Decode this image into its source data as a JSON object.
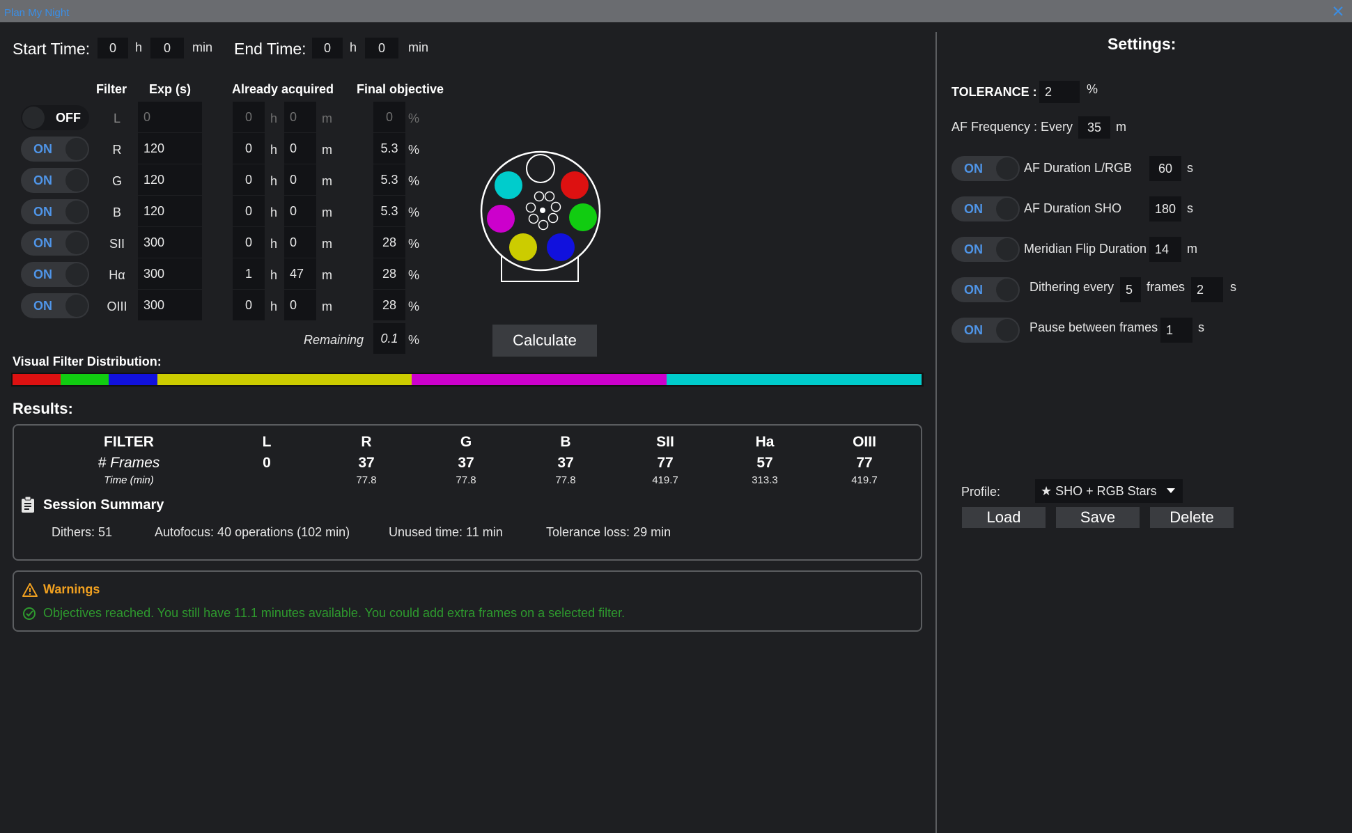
{
  "window": {
    "title": "Plan My Night"
  },
  "time": {
    "start_label": "Start Time:",
    "start_h": "0",
    "start_m": "0",
    "end_label": "End Time:",
    "end_h": "0",
    "end_m": "0",
    "h_unit": "h",
    "min_unit": "min"
  },
  "filters": {
    "headers": {
      "filter": "Filter",
      "exp": "Exp (s)",
      "acquired": "Already acquired",
      "objective": "Final objective"
    },
    "h_unit": "h",
    "m_unit": "m",
    "pct_unit": "%",
    "rows": [
      {
        "state": "OFF",
        "name": "L",
        "exp": "0",
        "acq_h": "0",
        "acq_m": "0",
        "objective": "0"
      },
      {
        "state": "ON",
        "name": "R",
        "exp": "120",
        "acq_h": "0",
        "acq_m": "0",
        "objective": "5.3"
      },
      {
        "state": "ON",
        "name": "G",
        "exp": "120",
        "acq_h": "0",
        "acq_m": "0",
        "objective": "5.3"
      },
      {
        "state": "ON",
        "name": "B",
        "exp": "120",
        "acq_h": "0",
        "acq_m": "0",
        "objective": "5.3"
      },
      {
        "state": "ON",
        "name": "SII",
        "exp": "300",
        "acq_h": "0",
        "acq_m": "0",
        "objective": "28"
      },
      {
        "state": "ON",
        "name": "Hα",
        "exp": "300",
        "acq_h": "1",
        "acq_m": "47",
        "objective": "28"
      },
      {
        "state": "ON",
        "name": "OIII",
        "exp": "300",
        "acq_h": "0",
        "acq_m": "0",
        "objective": "28"
      }
    ],
    "remaining_label": "Remaining",
    "remaining_value": "0.1"
  },
  "filter_wheel": {
    "colors": [
      "#ffffff",
      "#dd1111",
      "#11cc11",
      "#1111dd",
      "#cccc00",
      "#cc00cc",
      "#00cccc"
    ]
  },
  "calculate_label": "Calculate",
  "distribution": {
    "label": "Visual Filter Distribution:",
    "segments": [
      {
        "color": "#dd1111",
        "fraction": 0.053
      },
      {
        "color": "#11cc11",
        "fraction": 0.053
      },
      {
        "color": "#1111dd",
        "fraction": 0.053
      },
      {
        "color": "#cccc00",
        "fraction": 0.28
      },
      {
        "color": "#cc00cc",
        "fraction": 0.28
      },
      {
        "color": "#00cccc",
        "fraction": 0.28
      }
    ]
  },
  "results": {
    "title": "Results:",
    "row_labels": {
      "filter": "FILTER",
      "frames": "# Frames",
      "time": "Time (min)"
    },
    "columns": [
      {
        "name": "L",
        "frames": "0",
        "time": ""
      },
      {
        "name": "R",
        "frames": "37",
        "time": "77.8"
      },
      {
        "name": "G",
        "frames": "37",
        "time": "77.8"
      },
      {
        "name": "B",
        "frames": "37",
        "time": "77.8"
      },
      {
        "name": "SII",
        "frames": "77",
        "time": "419.7"
      },
      {
        "name": "Ha",
        "frames": "57",
        "time": "313.3"
      },
      {
        "name": "OIII",
        "frames": "77",
        "time": "419.7"
      }
    ],
    "session_summary_title": "Session Summary",
    "summary": {
      "dithers": "Dithers: 51",
      "autofocus": "Autofocus: 40 operations (102 min)",
      "unused": "Unused time: 11 min",
      "tolerance_loss": "Tolerance loss: 29 min"
    }
  },
  "warnings": {
    "title": "Warnings",
    "message": "Objectives reached. You still have 11.1 minutes available. You could add extra frames on a selected filter."
  },
  "settings": {
    "title": "Settings:",
    "tolerance_label": "TOLERANCE :",
    "tolerance_value": "2",
    "tolerance_unit": "%",
    "af_freq_label": "AF Frequency : Every",
    "af_freq_value": "35",
    "af_freq_unit": "m",
    "af_lrgb": {
      "state": "ON",
      "label": "AF Duration L/RGB",
      "value": "60",
      "unit": "s"
    },
    "af_sho": {
      "state": "ON",
      "label": "AF Duration SHO",
      "value": "180",
      "unit": "s"
    },
    "meridian": {
      "state": "ON",
      "label": "Meridian Flip Duration",
      "value": "14",
      "unit": "m"
    },
    "dithering": {
      "state": "ON",
      "label": "Dithering every",
      "value": "5",
      "frames_label": "frames",
      "value2": "2",
      "unit": "s"
    },
    "pause": {
      "state": "ON",
      "label": "Pause between frames",
      "value": "1",
      "unit": "s"
    },
    "profile_label": "Profile:",
    "profile_value": "★ SHO + RGB Stars",
    "load_label": "Load",
    "save_label": "Save",
    "delete_label": "Delete"
  }
}
